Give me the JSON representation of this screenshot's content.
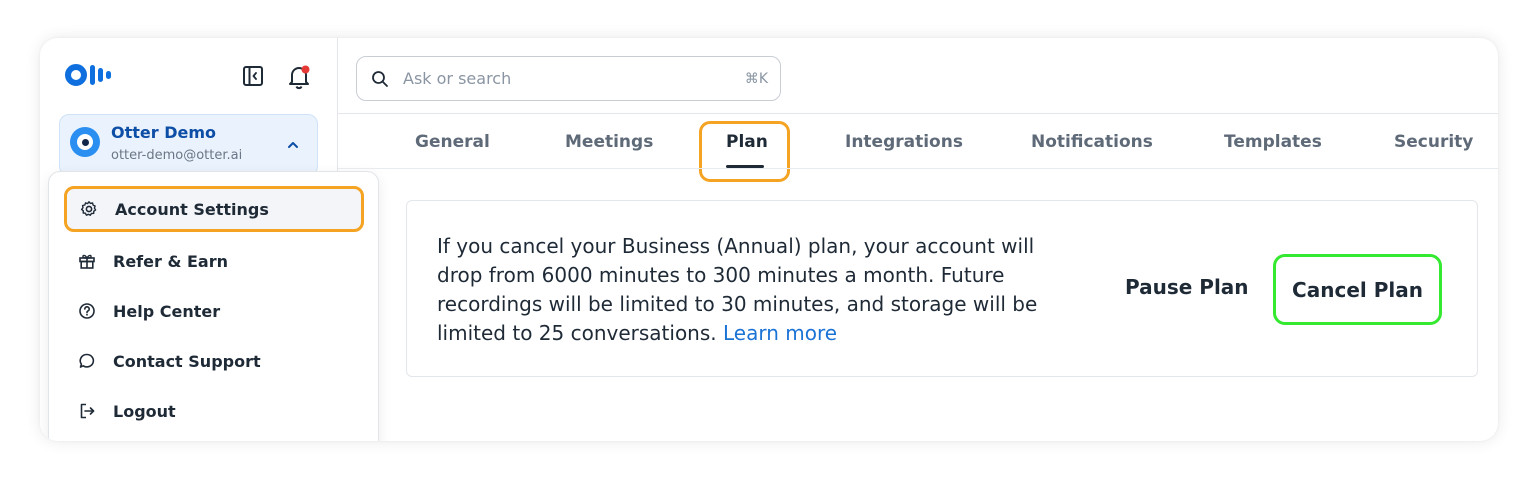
{
  "brand": {
    "logo_alt": "Otter",
    "accent": "#0f6fde"
  },
  "sidebar": {
    "collapse_icon": "sidebar-collapse-icon",
    "bell_icon": "bell-icon",
    "user": {
      "name": "Otter Demo",
      "email": "otter-demo@otter.ai"
    }
  },
  "menu": {
    "items": [
      {
        "label": "Account Settings",
        "icon": "gear-icon"
      },
      {
        "label": "Refer & Earn",
        "icon": "gift-icon"
      },
      {
        "label": "Help Center",
        "icon": "help-icon"
      },
      {
        "label": "Contact Support",
        "icon": "chat-icon"
      },
      {
        "label": "Logout",
        "icon": "logout-icon"
      }
    ]
  },
  "search": {
    "placeholder": "Ask or search",
    "shortcut": "⌘K"
  },
  "tabs": [
    {
      "label": "General"
    },
    {
      "label": "Meetings"
    },
    {
      "label": "Plan"
    },
    {
      "label": "Integrations"
    },
    {
      "label": "Notifications"
    },
    {
      "label": "Templates"
    },
    {
      "label": "Security"
    }
  ],
  "active_tab": "Plan",
  "panel": {
    "message": "If you cancel your Business (Annual) plan, your account will drop from 6000 minutes to 300 minutes a month. Future recordings will be limited to 30 minutes, and storage will be limited to 25 conversations.",
    "learn_more": "Learn more",
    "pause_label": "Pause Plan",
    "cancel_label": "Cancel Plan"
  },
  "colors": {
    "highlight_orange": "#f5a323",
    "highlight_green": "#35e830",
    "link": "#1b73d6",
    "notification_dot": "#e53935"
  }
}
